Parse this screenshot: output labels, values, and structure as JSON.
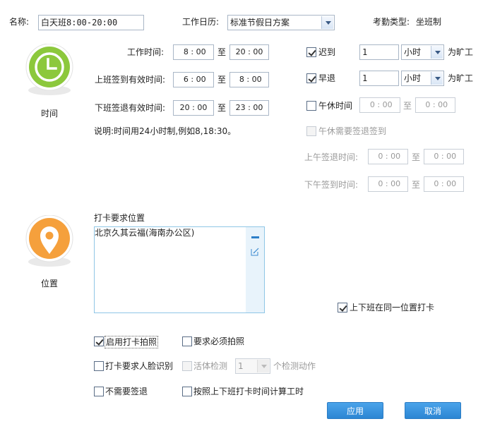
{
  "header": {
    "name_label": "名称:",
    "name_value": "白天班8:00-20:00",
    "calendar_label": "工作日历:",
    "calendar_value": "标准节假日方案",
    "type_label": "考勤类型:",
    "type_value": "坐班制"
  },
  "time_section": {
    "icon_label": "时间",
    "work_time_label": "工作时间:",
    "work_start": " 8 : 00",
    "work_end": "20 : 00",
    "checkin_label": "上班签到有效时间:",
    "checkin_start": " 6 : 00",
    "checkin_end": " 8 : 00",
    "checkout_label": "下班签退有效时间:",
    "checkout_start": "20 : 00",
    "checkout_end": "23 : 00",
    "to": "至",
    "note": "说明:时间用24小时制,例如8,18:30。"
  },
  "rules": {
    "late_label": "迟到",
    "late_value": "1",
    "late_unit": "小时",
    "late_suffix": "为旷工",
    "early_label": "早退",
    "early_value": "1",
    "early_unit": "小时",
    "early_suffix": "为旷工",
    "lunch_label": "午休时间",
    "lunch_start": " 0 : 00",
    "lunch_end": " 0 : 00",
    "lunch_sign_label": "午休需要签退签到",
    "am_out_label": "上午签退时间:",
    "am_out_start": " 0 : 00",
    "am_out_end": " 0 : 00",
    "pm_in_label": "下午签到时间:",
    "pm_in_start": " 0 : 00",
    "pm_in_end": " 0 : 00",
    "to": "至"
  },
  "location_section": {
    "icon_label": "位置",
    "title": "打卡要求位置",
    "locations": [
      "北京久其云福(海南办公区)"
    ],
    "same_location_label": "上下班在同一位置打卡"
  },
  "options": {
    "enable_photo": "启用打卡拍照",
    "require_photo": "要求必须拍照",
    "face_recog": "打卡要求人脸识别",
    "liveness": "活体检测",
    "liveness_count": "1",
    "liveness_suffix": "个检测动作",
    "no_checkout": "不需要签退",
    "calc_by_punch": "按照上下班打卡时间计算工时"
  },
  "buttons": {
    "apply": "应用",
    "cancel": "取消"
  },
  "colors": {
    "clock_green": "#8cc83c",
    "pin_orange": "#f5a03c",
    "button_blue": "#3592dc"
  }
}
